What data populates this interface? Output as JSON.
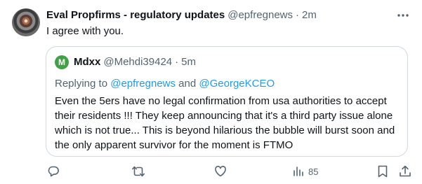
{
  "tweet": {
    "display_name": "Eval Propfirms - regulatory updates",
    "handle": "@epfregnews",
    "separator": "·",
    "time": "2m",
    "text": "I agree with you."
  },
  "quoted_tweet": {
    "avatar_initial": "M",
    "display_name": "Mdxx",
    "handle": "@Mehdi39424",
    "separator": "·",
    "time": "5m",
    "replying_prefix": "Replying to",
    "replying_mention_1": "@epfregnews",
    "replying_and": "and",
    "replying_mention_2": "@GeorgeKCEO",
    "text": "Even the 5ers have no legal confirmation from usa authorities to accept their residents !!! They keep announcing that it's a third party issue alone which is not true... This is beyond hilarious the bubble will burst soon and the only apparent survivor for the moment is FTMO"
  },
  "actions": {
    "views_count": "85"
  },
  "icons": {
    "more": "more-horizontal-icon",
    "reply": "reply-icon",
    "retweet": "retweet-icon",
    "like": "like-icon",
    "views": "views-icon",
    "bookmark": "bookmark-icon",
    "share": "share-icon"
  },
  "colors": {
    "text_primary": "#0f1419",
    "text_secondary": "#536471",
    "mention": "#1d9bf0",
    "border": "#cfd9de",
    "quoted_avatar": "#43a047"
  }
}
